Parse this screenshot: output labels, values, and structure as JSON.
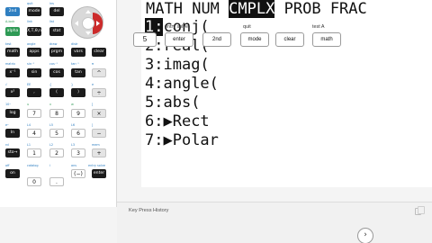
{
  "screen": {
    "menu_tabs": [
      "MATH",
      "NUM",
      "CMPLX",
      "PROB",
      "FRAC"
    ],
    "selected_tab": "CMPLX",
    "items": [
      {
        "num": "1:",
        "label": "conj("
      },
      {
        "num": "2:",
        "label": "real("
      },
      {
        "num": "3:",
        "label": "imag("
      },
      {
        "num": "4:",
        "label": "angle("
      },
      {
        "num": "5:",
        "label": "abs("
      },
      {
        "num": "6:",
        "label": "▶Rect"
      },
      {
        "num": "7:",
        "label": "▶Polar"
      }
    ],
    "selected_item": "1:"
  },
  "keypad": {
    "row1": {
      "keys": [
        "2nd",
        "mode",
        "del"
      ],
      "sec": [
        "",
        "quit",
        "ins"
      ]
    },
    "row2": {
      "keys": [
        "alpha",
        "X,T,θ,n",
        "stat"
      ],
      "sec": [
        "A-lock",
        "link",
        "list"
      ]
    },
    "row3": {
      "keys": [
        "math",
        "apps",
        "prgm",
        "vars",
        "clear"
      ],
      "sec": [
        "test",
        "angle",
        "draw",
        "distr",
        ""
      ]
    },
    "row4": {
      "keys": [
        "x⁻¹",
        "sin",
        "cos",
        "tan",
        "^"
      ],
      "sec": [
        "matrix",
        "sin⁻¹",
        "cos⁻¹",
        "tan⁻¹",
        "π"
      ]
    },
    "row5": {
      "keys": [
        "x²",
        ",",
        "(",
        ")",
        "÷"
      ],
      "sec": [
        "√",
        "EE",
        "{",
        "}",
        "e"
      ]
    },
    "row6": {
      "keys": [
        "log",
        "7",
        "8",
        "9",
        "×"
      ],
      "sec": [
        "10ˣ",
        "u",
        "v",
        "w",
        "["
      ]
    },
    "row7": {
      "keys": [
        "ln",
        "4",
        "5",
        "6",
        "−"
      ],
      "sec": [
        "eˣ",
        "L4",
        "L5",
        "L6",
        "]"
      ]
    },
    "row8": {
      "keys": [
        "sto→",
        "1",
        "2",
        "3",
        "+"
      ],
      "sec": [
        "rcl",
        "L1",
        "L2",
        "L3",
        "mem"
      ]
    },
    "row9": {
      "keys": [
        "on",
        "0",
        ".",
        "(−)",
        "enter"
      ],
      "sec": [
        "off",
        "catalog",
        "i",
        "ans",
        "entry solve"
      ]
    },
    "dpad_icon": "arrow-dpad"
  },
  "history": {
    "title": "Key Press History",
    "keys": [
      {
        "label": "5",
        "sec": ""
      },
      {
        "label": "enter",
        "sec": "entry solve"
      },
      {
        "label": "2nd",
        "sec": ""
      },
      {
        "label": "mode",
        "sec": "quit"
      },
      {
        "label": "clear",
        "sec": ""
      },
      {
        "label": "math",
        "sec": "test      A"
      }
    ],
    "next_label": "›",
    "copy_icon": "copy-icon"
  },
  "colors": {
    "blue_key": "#2f7fc1",
    "dark_key": "#1b1b1b",
    "dpad_red": "#cc2b2b"
  }
}
